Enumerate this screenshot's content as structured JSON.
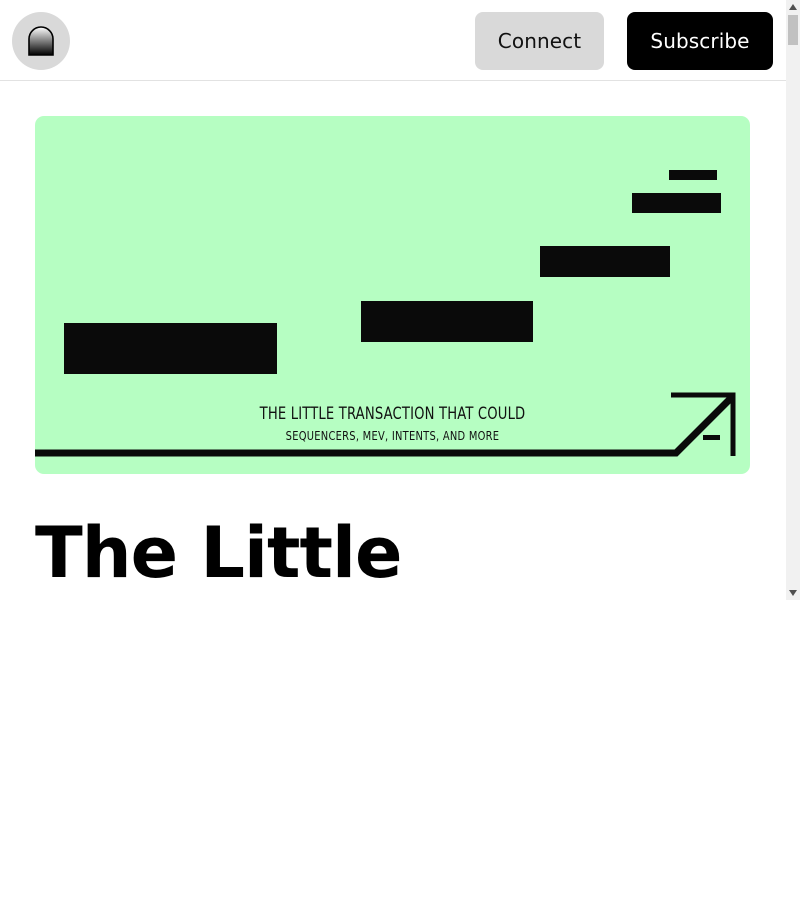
{
  "header": {
    "logo_icon": "arch-logo-icon",
    "connect_label": "Connect",
    "subscribe_label": "Subscribe"
  },
  "hero": {
    "title": "THE LITTLE TRANSACTION THAT COULD",
    "subtitle": "SEQUENCERS, MEV, INTENTS, AND MORE",
    "background_color": "#b6fec2",
    "arrow_icon": "arrow-up-right-icon"
  },
  "article": {
    "title_visible": "The Little"
  },
  "scrollbar": {
    "up_icon": "scroll-up-arrow-icon",
    "down_icon": "scroll-down-arrow-icon"
  }
}
